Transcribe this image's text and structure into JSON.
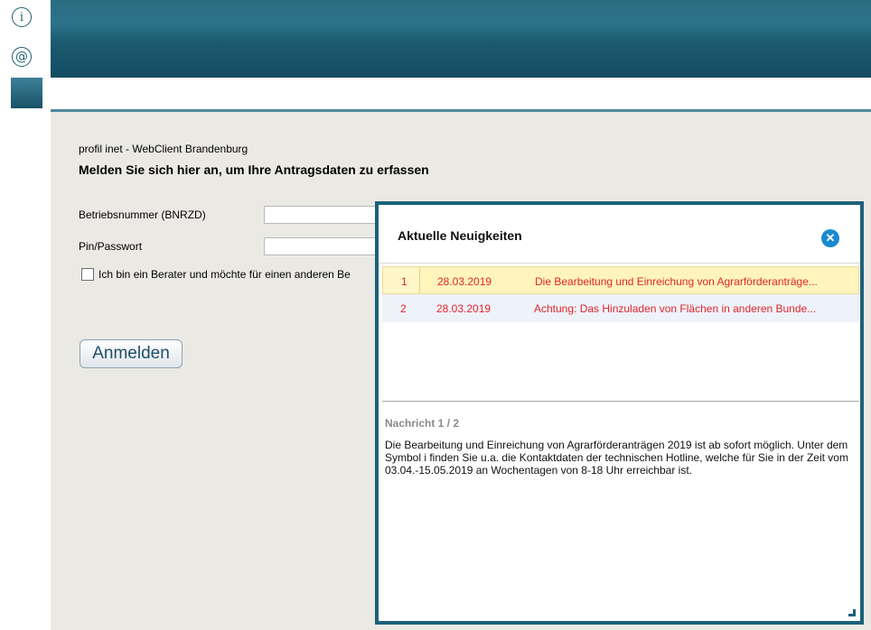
{
  "sidebar": {
    "info_glyph": "i",
    "at_glyph": "@",
    "icons": [
      "info-icon",
      "at-icon"
    ]
  },
  "colors": {
    "header": "#1b5a70",
    "content_bg": "#ebe9e4",
    "dialog_border": "#1c617a",
    "news_text": "#e0262c",
    "selected_row": "#fff5bc",
    "close_button": "#1a89d0"
  },
  "login": {
    "app_name": "profil inet - WebClient Brandenburg",
    "headline": "Melden Sie sich hier an, um Ihre Antragsdaten zu erfassen",
    "bnr_label": "Betriebsnummer (BNRZD)",
    "bnr_value": "",
    "pin_label": "Pin/Passwort",
    "pin_value": "",
    "advisor_label": "Ich bin ein Berater und möchte für einen anderen Be",
    "advisor_checked": false,
    "button_label": "Anmelden"
  },
  "news": {
    "title": "Aktuelle Neuigkeiten",
    "close_glyph": "✕",
    "items": [
      {
        "num": "1",
        "date": "28.03.2019",
        "subject": "Die Bearbeitung und Einreichung von Agrarförderanträge..."
      },
      {
        "num": "2",
        "date": "28.03.2019",
        "subject": "Achtung: Das Hinzuladen von Flächen in anderen Bunde..."
      }
    ],
    "message_header": "Nachricht 1 / 2",
    "message_body": "Die Bearbeitung und Einreichung von Agrarförderanträgen 2019 ist ab sofort möglich. Unter dem Symbol i finden Sie u.a. die Kontaktdaten der technischen Hotline, welche für Sie in der Zeit vom 03.04.-15.05.2019 an Wochentagen von 8-18 Uhr erreichbar ist."
  }
}
